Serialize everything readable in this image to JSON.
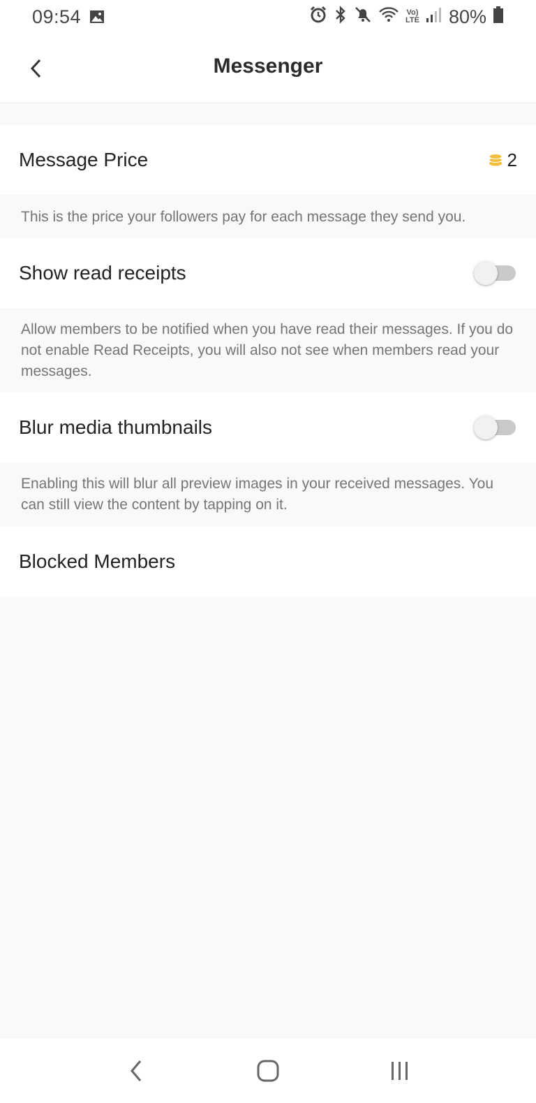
{
  "status_bar": {
    "time": "09:54",
    "lte_top": "Vo)",
    "lte_bottom": "LTE",
    "battery": "80%"
  },
  "app_bar": {
    "title": "Messenger"
  },
  "settings": {
    "message_price": {
      "label": "Message Price",
      "value": "2",
      "icon": "coins-icon",
      "description": "This is the price your followers pay for each message they send you."
    },
    "read_receipts": {
      "label": "Show read receipts",
      "enabled": false,
      "description": "Allow members to be notified when you have read their messages. If you do not enable Read Receipts, you will also not see when members read your messages."
    },
    "blur_media": {
      "label": "Blur media thumbnails",
      "enabled": false,
      "description": "Enabling this will blur all preview images in your received messages. You can still view the content by tapping on it."
    },
    "blocked_members": {
      "label": "Blocked Members"
    }
  },
  "colors": {
    "coin": "#F2BE3C",
    "background": "#F9F9F9",
    "toggle_track_off": "#C9C9C9"
  }
}
